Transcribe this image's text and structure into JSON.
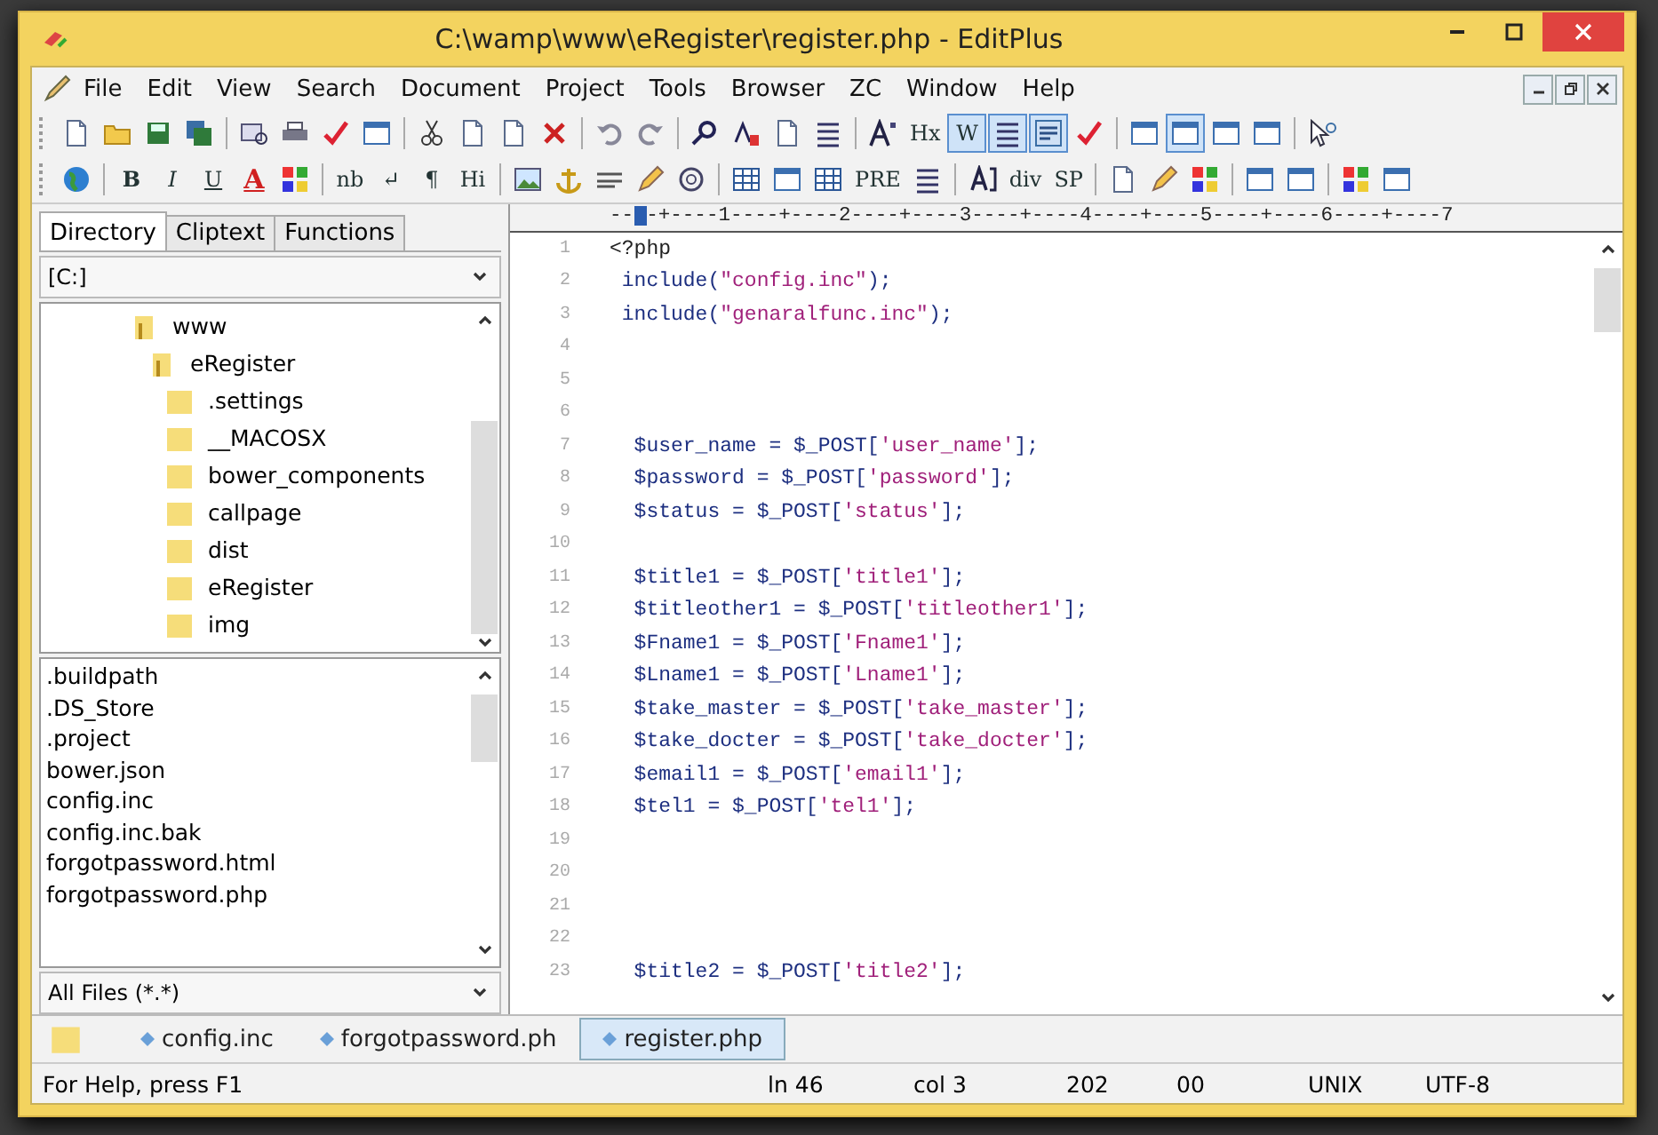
{
  "window": {
    "title": "C:\\wamp\\www\\eRegister\\register.php - EditPlus"
  },
  "menu": [
    "File",
    "Edit",
    "View",
    "Search",
    "Document",
    "Project",
    "Tools",
    "Browser",
    "ZC",
    "Window",
    "Help"
  ],
  "toolbars": [
    {
      "items": [
        {
          "kind": "icon",
          "pressed": false
        },
        {
          "kind": "icon",
          "pressed": false
        },
        {
          "kind": "icon",
          "pressed": false
        },
        {
          "kind": "icon",
          "pressed": false
        },
        {
          "kind": "separator"
        },
        {
          "kind": "icon",
          "pressed": false
        },
        {
          "kind": "icon",
          "pressed": false
        },
        {
          "kind": "icon",
          "pressed": false
        },
        {
          "kind": "icon",
          "pressed": false
        },
        {
          "kind": "separator"
        },
        {
          "kind": "icon",
          "pressed": false
        },
        {
          "kind": "icon",
          "pressed": false
        },
        {
          "kind": "icon",
          "pressed": false
        },
        {
          "kind": "icon",
          "pressed": false
        },
        {
          "kind": "separator"
        },
        {
          "kind": "icon",
          "pressed": false
        },
        {
          "kind": "icon",
          "pressed": false
        },
        {
          "kind": "separator"
        },
        {
          "kind": "icon",
          "pressed": false
        },
        {
          "kind": "icon",
          "pressed": false
        },
        {
          "kind": "icon",
          "pressed": false
        },
        {
          "kind": "icon",
          "pressed": false
        },
        {
          "kind": "separator"
        },
        {
          "kind": "icon",
          "pressed": false
        },
        {
          "kind": "text",
          "label": "Hx",
          "pressed": false
        },
        {
          "kind": "text",
          "label": "W",
          "pressed": true
        },
        {
          "kind": "icon",
          "pressed": true
        },
        {
          "kind": "icon",
          "pressed": true
        },
        {
          "kind": "icon",
          "pressed": false
        },
        {
          "kind": "separator"
        },
        {
          "kind": "icon",
          "pressed": false
        },
        {
          "kind": "icon",
          "pressed": true
        },
        {
          "kind": "icon",
          "pressed": false
        },
        {
          "kind": "icon",
          "pressed": false
        },
        {
          "kind": "separator"
        },
        {
          "kind": "icon",
          "pressed": false
        }
      ]
    },
    {
      "items": [
        {
          "kind": "icon",
          "pressed": false
        },
        {
          "kind": "separator"
        },
        {
          "kind": "bold",
          "label": "B",
          "pressed": false
        },
        {
          "kind": "italic",
          "label": "I",
          "pressed": false
        },
        {
          "kind": "underline",
          "label": "U",
          "pressed": false
        },
        {
          "kind": "colortext",
          "label": "A",
          "pressed": false
        },
        {
          "kind": "icon",
          "pressed": false
        },
        {
          "kind": "separator"
        },
        {
          "kind": "text",
          "label": "nb",
          "pressed": false
        },
        {
          "kind": "text",
          "label": "↵",
          "pressed": false
        },
        {
          "kind": "text",
          "label": "¶",
          "pressed": false
        },
        {
          "kind": "text",
          "label": "Hi",
          "pressed": false
        },
        {
          "kind": "separator"
        },
        {
          "kind": "icon",
          "pressed": false
        },
        {
          "kind": "icon",
          "pressed": false
        },
        {
          "kind": "icon",
          "pressed": false
        },
        {
          "kind": "icon",
          "pressed": false
        },
        {
          "kind": "icon",
          "pressed": false
        },
        {
          "kind": "separator"
        },
        {
          "kind": "icon",
          "pressed": false
        },
        {
          "kind": "icon",
          "pressed": false
        },
        {
          "kind": "icon",
          "pressed": false
        },
        {
          "kind": "text",
          "label": "PRE",
          "pressed": false
        },
        {
          "kind": "icon",
          "pressed": false
        },
        {
          "kind": "separator"
        },
        {
          "kind": "icon",
          "pressed": false
        },
        {
          "kind": "text",
          "label": "div",
          "pressed": false
        },
        {
          "kind": "text",
          "label": "SP",
          "pressed": false
        },
        {
          "kind": "separator"
        },
        {
          "kind": "icon",
          "pressed": false
        },
        {
          "kind": "icon",
          "pressed": false
        },
        {
          "kind": "icon",
          "pressed": false
        },
        {
          "kind": "separator"
        },
        {
          "kind": "icon",
          "pressed": false
        },
        {
          "kind": "icon",
          "pressed": false
        },
        {
          "kind": "separator"
        },
        {
          "kind": "icon",
          "pressed": false
        },
        {
          "kind": "icon",
          "pressed": false
        }
      ]
    }
  ],
  "side_tabs": [
    {
      "label": "Directory",
      "selected": true
    },
    {
      "label": "Cliptext",
      "selected": false
    },
    {
      "label": "Functions",
      "selected": false
    }
  ],
  "drive": "[C:]",
  "tree": [
    {
      "label": "www",
      "expanded": true,
      "children": [
        {
          "label": "eRegister",
          "expanded": true,
          "children": [
            {
              "label": ".settings",
              "expanded": false
            },
            {
              "label": "__MACOSX",
              "expanded": false
            },
            {
              "label": "bower_components",
              "expanded": false
            },
            {
              "label": "callpage",
              "expanded": false
            },
            {
              "label": "dist",
              "expanded": false
            },
            {
              "label": "eRegister",
              "expanded": false
            },
            {
              "label": "img",
              "expanded": false
            }
          ]
        }
      ]
    }
  ],
  "files": [
    ".buildpath",
    ".DS_Store",
    ".project",
    "bower.json",
    "config.inc",
    "config.inc.bak",
    "forgotpassword.html",
    "forgotpassword.php"
  ],
  "filter": "All Files (*.*)",
  "ruler": {
    "before": "--",
    "after": "-+----1----+----2----+----3----+----4----+----5----+----6----+----7"
  },
  "code": [
    {
      "num": "1",
      "parts": [
        {
          "kind": "tag",
          "text": "<?php"
        }
      ]
    },
    {
      "num": "2",
      "parts": [
        {
          "kind": "code",
          "text": " include("
        },
        {
          "kind": "str",
          "text": "\"config.inc\""
        },
        {
          "kind": "code",
          "text": ");"
        }
      ]
    },
    {
      "num": "3",
      "parts": [
        {
          "kind": "code",
          "text": " include("
        },
        {
          "kind": "str",
          "text": "\"genaralfunc.inc\""
        },
        {
          "kind": "code",
          "text": ");"
        }
      ]
    },
    {
      "num": "4"
    },
    {
      "num": "5"
    },
    {
      "num": "6"
    },
    {
      "num": "7",
      "parts": [
        {
          "kind": "code",
          "text": "  $user_name = $_POST["
        },
        {
          "kind": "str",
          "text": "'user_name'"
        },
        {
          "kind": "code",
          "text": "];"
        }
      ]
    },
    {
      "num": "8",
      "parts": [
        {
          "kind": "code",
          "text": "  $password = $_POST["
        },
        {
          "kind": "str",
          "text": "'password'"
        },
        {
          "kind": "code",
          "text": "];"
        }
      ]
    },
    {
      "num": "9",
      "parts": [
        {
          "kind": "code",
          "text": "  $status = $_POST["
        },
        {
          "kind": "str",
          "text": "'status'"
        },
        {
          "kind": "code",
          "text": "];"
        }
      ]
    },
    {
      "num": "10"
    },
    {
      "num": "11",
      "parts": [
        {
          "kind": "code",
          "text": "  $title1 = $_POST["
        },
        {
          "kind": "str",
          "text": "'title1'"
        },
        {
          "kind": "code",
          "text": "];"
        }
      ]
    },
    {
      "num": "12",
      "parts": [
        {
          "kind": "code",
          "text": "  $titleother1 = $_POST["
        },
        {
          "kind": "str",
          "text": "'titleother1'"
        },
        {
          "kind": "code",
          "text": "];"
        }
      ]
    },
    {
      "num": "13",
      "parts": [
        {
          "kind": "code",
          "text": "  $Fname1 = $_POST["
        },
        {
          "kind": "str",
          "text": "'Fname1'"
        },
        {
          "kind": "code",
          "text": "];"
        }
      ]
    },
    {
      "num": "14",
      "parts": [
        {
          "kind": "code",
          "text": "  $Lname1 = $_POST["
        },
        {
          "kind": "str",
          "text": "'Lname1'"
        },
        {
          "kind": "code",
          "text": "];"
        }
      ]
    },
    {
      "num": "15",
      "parts": [
        {
          "kind": "code",
          "text": "  $take_master = $_POST["
        },
        {
          "kind": "str",
          "text": "'take_master'"
        },
        {
          "kind": "code",
          "text": "];"
        }
      ]
    },
    {
      "num": "16",
      "parts": [
        {
          "kind": "code",
          "text": "  $take_docter = $_POST["
        },
        {
          "kind": "str",
          "text": "'take_docter'"
        },
        {
          "kind": "code",
          "text": "];"
        }
      ]
    },
    {
      "num": "17",
      "parts": [
        {
          "kind": "code",
          "text": "  $email1 = $_POST["
        },
        {
          "kind": "str",
          "text": "'email1'"
        },
        {
          "kind": "code",
          "text": "];"
        }
      ]
    },
    {
      "num": "18",
      "parts": [
        {
          "kind": "code",
          "text": "  $tel1 = $_POST["
        },
        {
          "kind": "str",
          "text": "'tel1'"
        },
        {
          "kind": "code",
          "text": "];"
        }
      ]
    },
    {
      "num": "19"
    },
    {
      "num": "20"
    },
    {
      "num": "21"
    },
    {
      "num": "22"
    },
    {
      "num": "23",
      "parts": [
        {
          "kind": "code",
          "text": "  $title2 = $_POST["
        },
        {
          "kind": "str",
          "text": "'title2'"
        },
        {
          "kind": "code",
          "text": "];"
        }
      ]
    }
  ],
  "doc_tabs": [
    {
      "label": "config.inc",
      "selected": false
    },
    {
      "label": "forgotpassword.ph",
      "selected": false
    },
    {
      "label": "register.php",
      "selected": true
    }
  ],
  "status_bar": [
    "For Help, press F1",
    "ln 46",
    "col 3",
    "202",
    "00",
    "UNIX",
    "UTF-8"
  ]
}
